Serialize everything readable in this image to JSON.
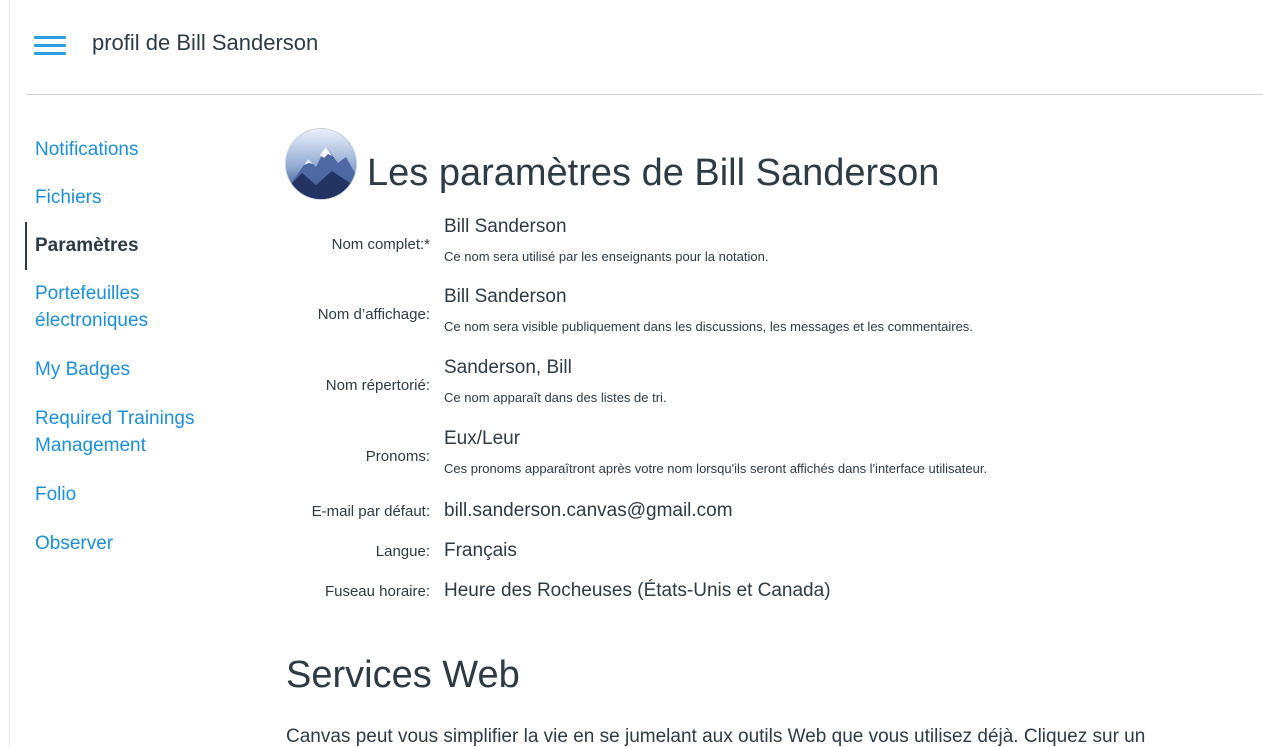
{
  "header": {
    "title": "profil de Bill Sanderson"
  },
  "sidebar": {
    "items": [
      {
        "label": "Notifications",
        "active": false
      },
      {
        "label": "Fichiers",
        "active": false
      },
      {
        "label": "Paramètres",
        "active": true
      },
      {
        "label": "Portefeuilles électroniques",
        "line1": "Portefeuilles",
        "line2": "électroniques",
        "active": false
      },
      {
        "label": "My Badges",
        "active": false
      },
      {
        "label": "Required Trainings Management",
        "line1": "Required Trainings",
        "line2": "Management",
        "active": false
      },
      {
        "label": "Folio",
        "active": false
      },
      {
        "label": "Observer",
        "active": false
      }
    ]
  },
  "main": {
    "title": "Les paramètres de Bill Sanderson",
    "fields": [
      {
        "label": "Nom complet:*",
        "value": "Bill Sanderson",
        "hint": "Ce nom sera utilisé par les enseignants pour la notation."
      },
      {
        "label": "Nom d’affichage:",
        "value": "Bill Sanderson",
        "hint": "Ce nom sera visible publiquement dans les discussions, les messages et les commentaires."
      },
      {
        "label": "Nom répertorié:",
        "value": "Sanderson, Bill",
        "hint": "Ce nom apparaît dans des listes de tri."
      },
      {
        "label": "Pronoms:",
        "value": "Eux/Leur",
        "hint": "Ces pronoms apparaîtront après votre nom lorsqu'ils seront affichés dans l'interface utilisateur."
      },
      {
        "label": "E-mail par défaut:",
        "value": "bill.sanderson.canvas@gmail.com"
      },
      {
        "label": "Langue:",
        "value": "Français"
      },
      {
        "label": "Fuseau horaire:",
        "value": "Heure des Rocheuses (États-Unis et Canada)"
      }
    ],
    "services_title": "Services Web",
    "services_text": "Canvas peut vous simplifier la vie en se jumelant aux outils Web que vous utilisez déjà. Cliquez sur un"
  },
  "colors": {
    "link": "#1d8fd6",
    "text": "#2d3b45",
    "menu_icon": "#2b9fe3"
  },
  "icons": {
    "menu": "hamburger-menu-icon",
    "avatar": "mountain-avatar-image"
  }
}
